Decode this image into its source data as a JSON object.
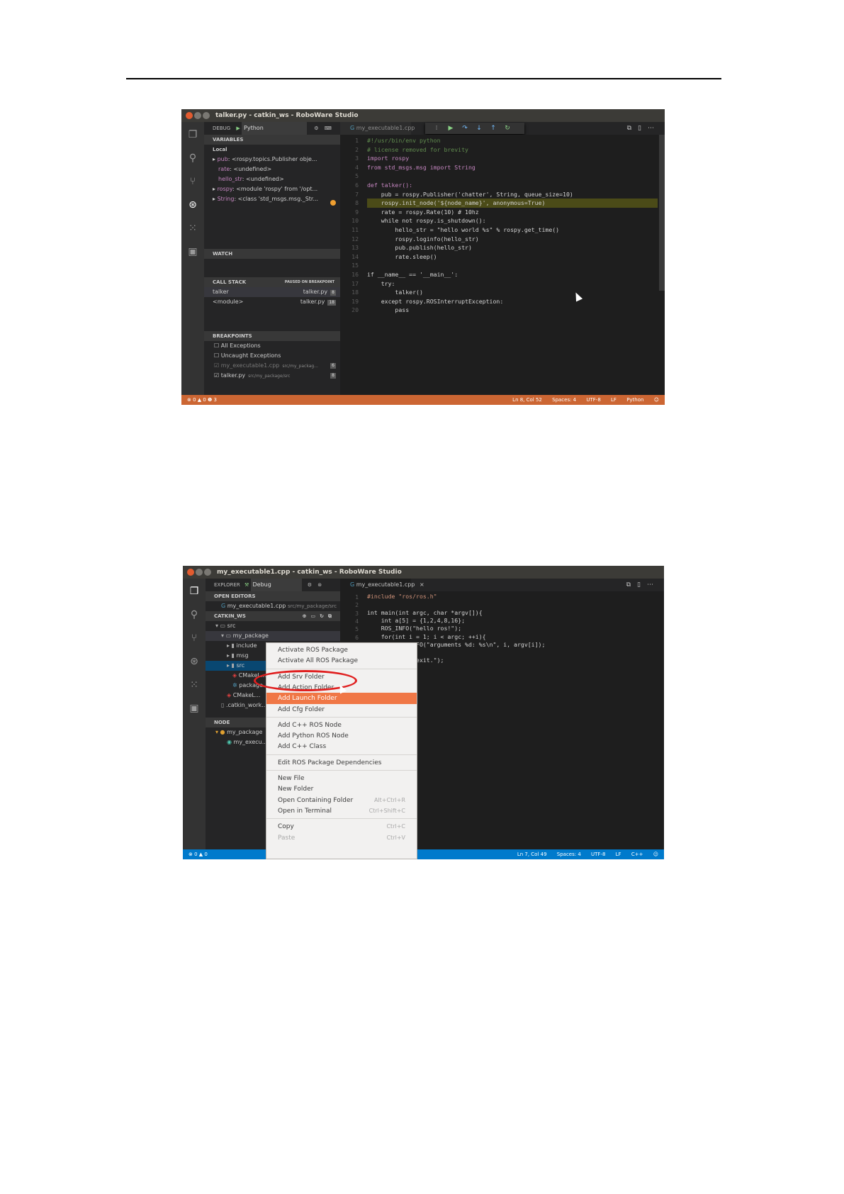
{
  "colors": {
    "debug_status": "#cc6633",
    "normal_status": "#007acc",
    "menu_highlight": "#f07746",
    "annotation_ring": "#e02020"
  },
  "win1": {
    "title": "talker.py - catkin_ws - RoboWare Studio",
    "debug_label": "DEBUG",
    "config": "Python",
    "tab": "my_executable1.cpp",
    "sections": {
      "variables": "VARIABLES",
      "local": "Local",
      "watch": "WATCH",
      "call_stack": "CALL STACK",
      "paused": "PAUSED ON BREAKPOINT",
      "breakpoints": "BREAKPOINTS"
    },
    "variables": [
      {
        "name": "pub",
        "value": ": <rospy.topics.Publisher obje..."
      },
      {
        "name": "rate",
        "value": ": <undefined>"
      },
      {
        "name": "hello_str",
        "value": ": <undefined>"
      },
      {
        "name": "rospy",
        "value": ": <module 'rospy' from '/opt..."
      },
      {
        "name": "String",
        "value": ": <class 'std_msgs.msg._Str..."
      }
    ],
    "call_stack": [
      {
        "fn": "talker",
        "file": "talker.py",
        "line": "8"
      },
      {
        "fn": "<module>",
        "file": "talker.py",
        "line": "18"
      }
    ],
    "breakpoints": [
      {
        "label": "All Exceptions",
        "path": "",
        "line": ""
      },
      {
        "label": "Uncaught Exceptions",
        "path": "",
        "line": ""
      },
      {
        "label": "my_executable1.cpp",
        "path": "src/my_packag...",
        "line": "6"
      },
      {
        "label": "talker.py",
        "path": "src/my_package/src",
        "line": "8"
      }
    ],
    "code": [
      "#!/usr/bin/env python",
      "# license removed for brevity",
      "import rospy",
      "from std_msgs.msg import String",
      "",
      "def talker():",
      "    pub = rospy.Publisher('chatter', String, queue_size=10)",
      "    rospy.init_node('${node_name}', anonymous=True)",
      "    rate = rospy.Rate(10) # 10hz",
      "    while not rospy.is_shutdown():",
      "        hello_str = \"hello world %s\" % rospy.get_time()",
      "        rospy.loginfo(hello_str)",
      "        pub.publish(hello_str)",
      "        rate.sleep()",
      "",
      "if __name__ == '__main__':",
      "    try:",
      "        talker()",
      "    except rospy.ROSInterruptException:",
      "        pass"
    ],
    "status": {
      "left": "⊗ 0 ▲ 0 ❶ 3",
      "pos": "Ln 8, Col 52",
      "spaces": "Spaces: 4",
      "enc": "UTF-8",
      "eol": "LF",
      "lang": "Python"
    }
  },
  "win2": {
    "title": "my_executable1.cpp - catkin_ws - RoboWare Studio",
    "explorer_label": "EXPLORER",
    "config": "Debug",
    "tab": "my_executable1.cpp",
    "sections": {
      "open_editors": "OPEN EDITORS",
      "catkin_ws": "CATKIN_WS",
      "node": "NODE"
    },
    "open_editor": {
      "name": "my_executable1.cpp",
      "path": "src/my_package/src"
    },
    "tree": [
      "src",
      "my_package",
      "include",
      "msg",
      "src",
      "CMakeL...",
      "package...",
      "CMakeL...",
      ".catkin_work..."
    ],
    "node_tree": [
      "my_package",
      "my_execu..."
    ],
    "code": [
      "#include \"ros/ros.h\"",
      "",
      "int main(int argc, char *argv[]){",
      "    int a[5] = {1,2,4,8,16};",
      "    ROS_INFO(\"hello ros!\");",
      "    for(int i = 1; i < argc; ++i){",
      "        ROS_INFO(\"arguments %d: %s\\n\", i, argv[i]);",
      "    }",
      "    ROS_INFO(\"exit.\");",
      "}"
    ],
    "menu": [
      {
        "label": "Activate ROS Package",
        "shortcut": "",
        "disabled": false
      },
      {
        "label": "Activate All ROS Package",
        "shortcut": "",
        "disabled": false
      },
      {
        "label": "Add Srv Folder",
        "shortcut": "",
        "disabled": false
      },
      {
        "label": "Add Action Folder",
        "shortcut": "",
        "disabled": false
      },
      {
        "label": "Add Launch Folder",
        "shortcut": "",
        "disabled": false
      },
      {
        "label": "Add Cfg Folder",
        "shortcut": "",
        "disabled": false
      },
      {
        "label": "Add C++ ROS Node",
        "shortcut": "",
        "disabled": false
      },
      {
        "label": "Add Python ROS Node",
        "shortcut": "",
        "disabled": false
      },
      {
        "label": "Add C++ Class",
        "shortcut": "",
        "disabled": false
      },
      {
        "label": "Edit ROS Package Dependencies",
        "shortcut": "",
        "disabled": false
      },
      {
        "label": "New File",
        "shortcut": "",
        "disabled": false
      },
      {
        "label": "New Folder",
        "shortcut": "",
        "disabled": false
      },
      {
        "label": "Open Containing Folder",
        "shortcut": "Alt+Ctrl+R",
        "disabled": false
      },
      {
        "label": "Open in Terminal",
        "shortcut": "Ctrl+Shift+C",
        "disabled": false
      },
      {
        "label": "Copy",
        "shortcut": "Ctrl+C",
        "disabled": false
      },
      {
        "label": "Paste",
        "shortcut": "Ctrl+V",
        "disabled": true
      }
    ],
    "status": {
      "left": "⊗ 0 ▲ 0",
      "pos": "Ln 7, Col 49",
      "spaces": "Spaces: 4",
      "enc": "UTF-8",
      "eol": "LF",
      "lang": "C++"
    }
  }
}
